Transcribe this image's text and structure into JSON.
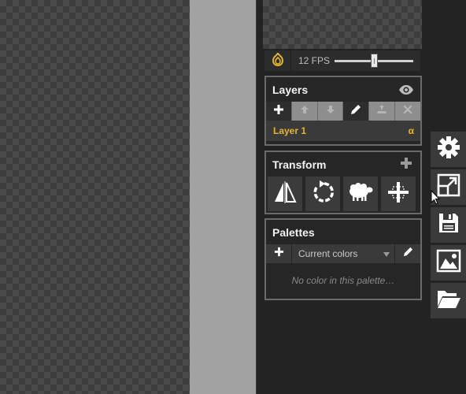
{
  "preview": {
    "fps_label": "12 FPS",
    "fps_level": 0.5
  },
  "layers": {
    "title": "Layers",
    "items": [
      {
        "name": "Layer 1",
        "alpha_symbol": "α"
      }
    ]
  },
  "transform": {
    "title": "Transform"
  },
  "palettes": {
    "title": "Palettes",
    "selected_palette": "Current colors",
    "empty_message": "No color in this palette…"
  },
  "colors": {
    "accent": "#e3b52c",
    "panel_border": "#6a6a6a",
    "panel_background": "#262626",
    "canvas_gutter": "#a2a2a2"
  },
  "icons": {
    "onion_skin": "onion-icon",
    "layers_visibility": "eye-icon",
    "layer_tools": [
      "plus-icon",
      "arrow-up-icon",
      "arrow-down-icon",
      "pencil-icon",
      "merge-down-icon",
      "close-icon"
    ],
    "transform_tools": [
      "flip-icon",
      "rotate-icon",
      "sheep-icon",
      "align-icon"
    ],
    "side_tools": [
      "gear-icon",
      "resize-icon",
      "save-icon",
      "image-icon",
      "folder-open-icon"
    ]
  }
}
